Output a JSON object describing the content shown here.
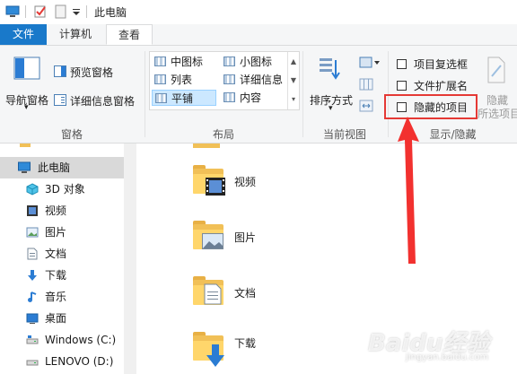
{
  "window": {
    "title": "此电脑"
  },
  "tabs": [
    {
      "label": "文件"
    },
    {
      "label": "计算机"
    },
    {
      "label": "查看"
    }
  ],
  "ribbon": {
    "panes_group": {
      "nav_pane": "导航窗格",
      "preview_pane": "预览窗格",
      "details_pane": "详细信息窗格",
      "label": "窗格"
    },
    "layout_group": {
      "items": [
        "中图标",
        "小图标",
        "列表",
        "详细信息",
        "平铺",
        "内容"
      ],
      "label": "布局"
    },
    "current_view_group": {
      "sort_by": "排序方式",
      "label": "当前视图"
    },
    "show_hide_group": {
      "item_checkboxes": "项目复选框",
      "file_extensions": "文件扩展名",
      "hidden_items": "隐藏的项目",
      "hide_selected": "隐藏",
      "hide_selected_sub": "所选项目",
      "label": "显示/隐藏"
    }
  },
  "nav_pane": {
    "items": [
      {
        "label": "此电脑",
        "icon": "computer-icon"
      },
      {
        "label": "3D 对象",
        "icon": "cube-icon"
      },
      {
        "label": "视频",
        "icon": "video-icon"
      },
      {
        "label": "图片",
        "icon": "picture-icon"
      },
      {
        "label": "文档",
        "icon": "document-icon"
      },
      {
        "label": "下载",
        "icon": "download-icon"
      },
      {
        "label": "音乐",
        "icon": "music-icon"
      },
      {
        "label": "桌面",
        "icon": "desktop-icon"
      },
      {
        "label": "Windows (C:)",
        "icon": "drive-icon"
      },
      {
        "label": "LENOVO (D:)",
        "icon": "drive-icon"
      }
    ]
  },
  "content": {
    "folders": [
      {
        "label": "视频"
      },
      {
        "label": "图片"
      },
      {
        "label": "文档"
      },
      {
        "label": "下载"
      }
    ]
  },
  "watermark": {
    "text": "Baidu经验",
    "sub": "jingyan.baidu.com"
  },
  "colors": {
    "accent": "#1979ca",
    "highlight": "#e53935",
    "folder": "#ffd66b",
    "selected_nav": "#d9d9d9"
  }
}
